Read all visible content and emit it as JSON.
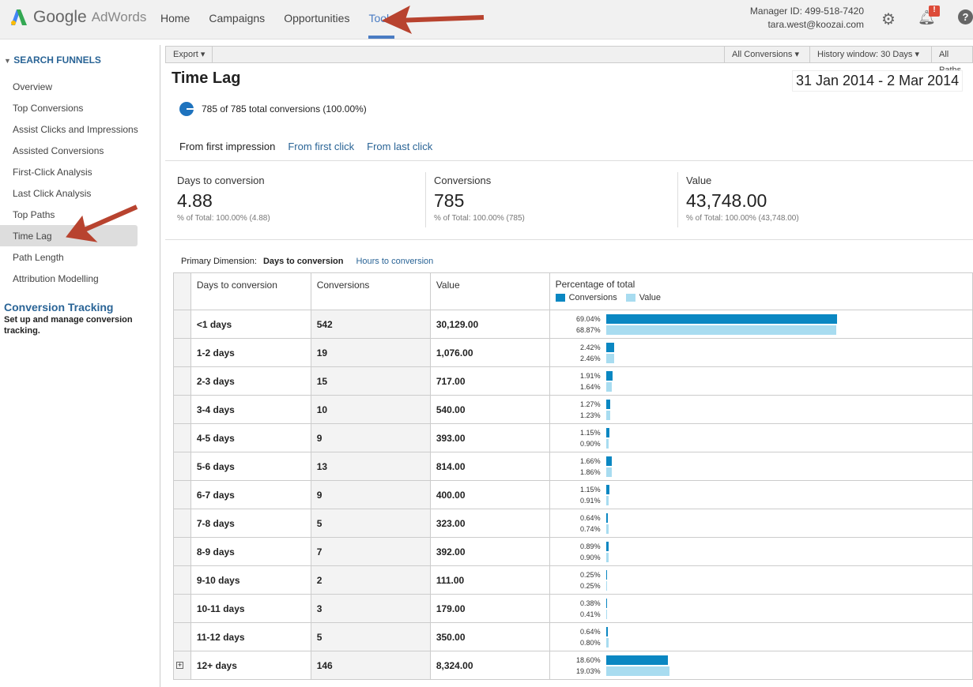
{
  "header": {
    "logo_google": "Google",
    "logo_adwords": "AdWords",
    "nav": [
      "Home",
      "Campaigns",
      "Opportunities",
      "Tools"
    ],
    "active_nav": "Tools",
    "manager_id": "Manager ID: 499-518-7420",
    "email": "tara.west@koozai.com",
    "notification_badge": "!"
  },
  "sidebar": {
    "heading": "SEARCH FUNNELS",
    "items": [
      "Overview",
      "Top Conversions",
      "Assist Clicks and Impressions",
      "Assisted Conversions",
      "First-Click Analysis",
      "Last Click Analysis",
      "Top Paths",
      "Time Lag",
      "Path Length",
      "Attribution Modelling"
    ],
    "selected": "Time Lag",
    "conversion_tracking_title": "Conversion Tracking",
    "conversion_tracking_desc": "Set up and manage conversion tracking."
  },
  "toolbar": {
    "export": "Export ▾",
    "all_conversions": "All Conversions ▾",
    "history_window": "History window: 30 Days ▾",
    "all_paths": "All Paths"
  },
  "page": {
    "title": "Time Lag",
    "date_range": "31 Jan 2014 - 2 Mar 2014",
    "totals": "785 of 785 total conversions (100.00%)",
    "subtabs": [
      "From first impression",
      "From first click",
      "From last click"
    ]
  },
  "scorecards": [
    {
      "label": "Days to conversion",
      "value": "4.88",
      "sub": "% of Total: 100.00% (4.88)"
    },
    {
      "label": "Conversions",
      "value": "785",
      "sub": "% of Total: 100.00% (785)"
    },
    {
      "label": "Value",
      "value": "43,748.00",
      "sub": "% of Total: 100.00% (43,748.00)"
    }
  ],
  "dimension": {
    "label": "Primary Dimension:",
    "active": "Days to conversion",
    "other": "Hours to conversion"
  },
  "table": {
    "headers": [
      "Days to conversion",
      "Conversions",
      "Value",
      "Percentage of total"
    ],
    "legend": [
      "Conversions",
      "Value"
    ],
    "colors": {
      "conversions": "#0a87c2",
      "value": "#a8dcf0"
    },
    "rows": [
      {
        "day": "<1 days",
        "conv": "542",
        "value": "30,129.00",
        "pc": 69.04,
        "pv": 68.87,
        "pcs": "69.04%",
        "pvs": "68.87%"
      },
      {
        "day": "1-2 days",
        "conv": "19",
        "value": "1,076.00",
        "pc": 2.42,
        "pv": 2.46,
        "pcs": "2.42%",
        "pvs": "2.46%"
      },
      {
        "day": "2-3 days",
        "conv": "15",
        "value": "717.00",
        "pc": 1.91,
        "pv": 1.64,
        "pcs": "1.91%",
        "pvs": "1.64%"
      },
      {
        "day": "3-4 days",
        "conv": "10",
        "value": "540.00",
        "pc": 1.27,
        "pv": 1.23,
        "pcs": "1.27%",
        "pvs": "1.23%"
      },
      {
        "day": "4-5 days",
        "conv": "9",
        "value": "393.00",
        "pc": 1.15,
        "pv": 0.9,
        "pcs": "1.15%",
        "pvs": "0.90%"
      },
      {
        "day": "5-6 days",
        "conv": "13",
        "value": "814.00",
        "pc": 1.66,
        "pv": 1.86,
        "pcs": "1.66%",
        "pvs": "1.86%"
      },
      {
        "day": "6-7 days",
        "conv": "9",
        "value": "400.00",
        "pc": 1.15,
        "pv": 0.91,
        "pcs": "1.15%",
        "pvs": "0.91%"
      },
      {
        "day": "7-8 days",
        "conv": "5",
        "value": "323.00",
        "pc": 0.64,
        "pv": 0.74,
        "pcs": "0.64%",
        "pvs": "0.74%"
      },
      {
        "day": "8-9 days",
        "conv": "7",
        "value": "392.00",
        "pc": 0.89,
        "pv": 0.9,
        "pcs": "0.89%",
        "pvs": "0.90%"
      },
      {
        "day": "9-10 days",
        "conv": "2",
        "value": "111.00",
        "pc": 0.25,
        "pv": 0.25,
        "pcs": "0.25%",
        "pvs": "0.25%"
      },
      {
        "day": "10-11 days",
        "conv": "3",
        "value": "179.00",
        "pc": 0.38,
        "pv": 0.41,
        "pcs": "0.38%",
        "pvs": "0.41%"
      },
      {
        "day": "11-12 days",
        "conv": "5",
        "value": "350.00",
        "pc": 0.64,
        "pv": 0.8,
        "pcs": "0.64%",
        "pvs": "0.80%"
      },
      {
        "day": "12+ days",
        "conv": "146",
        "value": "8,324.00",
        "pc": 18.6,
        "pv": 19.03,
        "pcs": "18.60%",
        "pvs": "19.03%",
        "expandable": true
      }
    ]
  }
}
